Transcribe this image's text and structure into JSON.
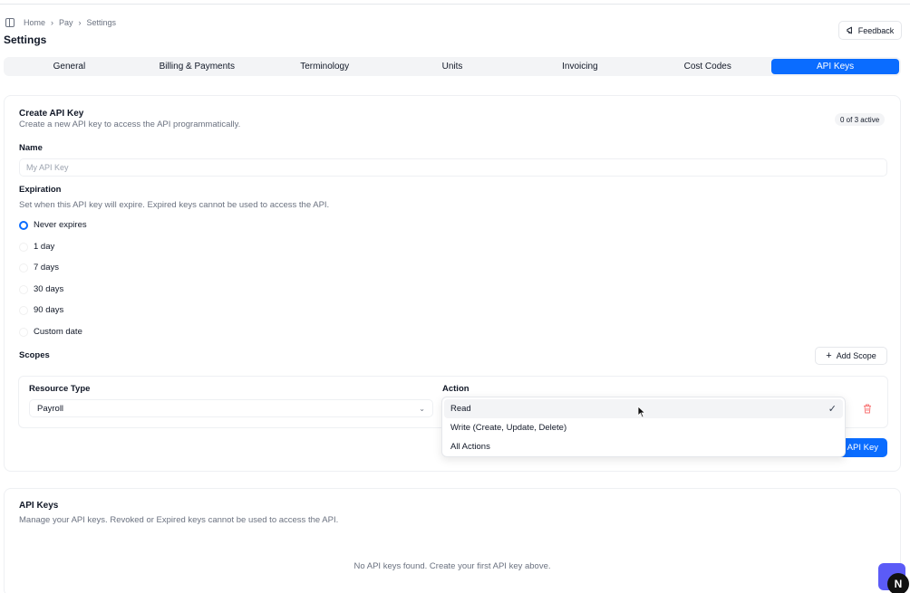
{
  "breadcrumb": {
    "items": [
      "Home",
      "Pay",
      "Settings"
    ]
  },
  "page_title": "Settings",
  "feedback_label": "Feedback",
  "tabs": [
    {
      "label": "General"
    },
    {
      "label": "Billing & Payments"
    },
    {
      "label": "Terminology"
    },
    {
      "label": "Units"
    },
    {
      "label": "Invoicing"
    },
    {
      "label": "Cost Codes"
    },
    {
      "label": "API Keys",
      "active": true
    }
  ],
  "create": {
    "title": "Create API Key",
    "description": "Create a new API key to access the API programmatically.",
    "active_badge": "0 of 3 active",
    "name_label": "Name",
    "name_placeholder": "My API Key",
    "name_value": "",
    "expiration_label": "Expiration",
    "expiration_desc": "Set when this API key will expire. Expired keys cannot be used to access the API.",
    "expiration_options": [
      {
        "label": "Never expires",
        "checked": true
      },
      {
        "label": "1 day"
      },
      {
        "label": "7 days"
      },
      {
        "label": "30 days"
      },
      {
        "label": "90 days"
      },
      {
        "label": "Custom date"
      }
    ],
    "scopes_label": "Scopes",
    "add_scope_label": "Add Scope",
    "resource_type_label": "Resource Type",
    "resource_type_value": "Payroll",
    "action_label": "Action",
    "submit_label": "API Key"
  },
  "action_dropdown": {
    "options": [
      {
        "label": "Read",
        "selected": true
      },
      {
        "label": "Write (Create, Update, Delete)"
      },
      {
        "label": "All Actions"
      }
    ]
  },
  "keys": {
    "title": "API Keys",
    "description": "Manage your API keys. Revoked or Expired keys cannot be used to access the API.",
    "empty_message": "No API keys found. Create your first API key above."
  },
  "badge_letter": "N",
  "colors": {
    "accent": "#0a6cff",
    "danger": "#ef4444",
    "muted": "#6b7280"
  }
}
